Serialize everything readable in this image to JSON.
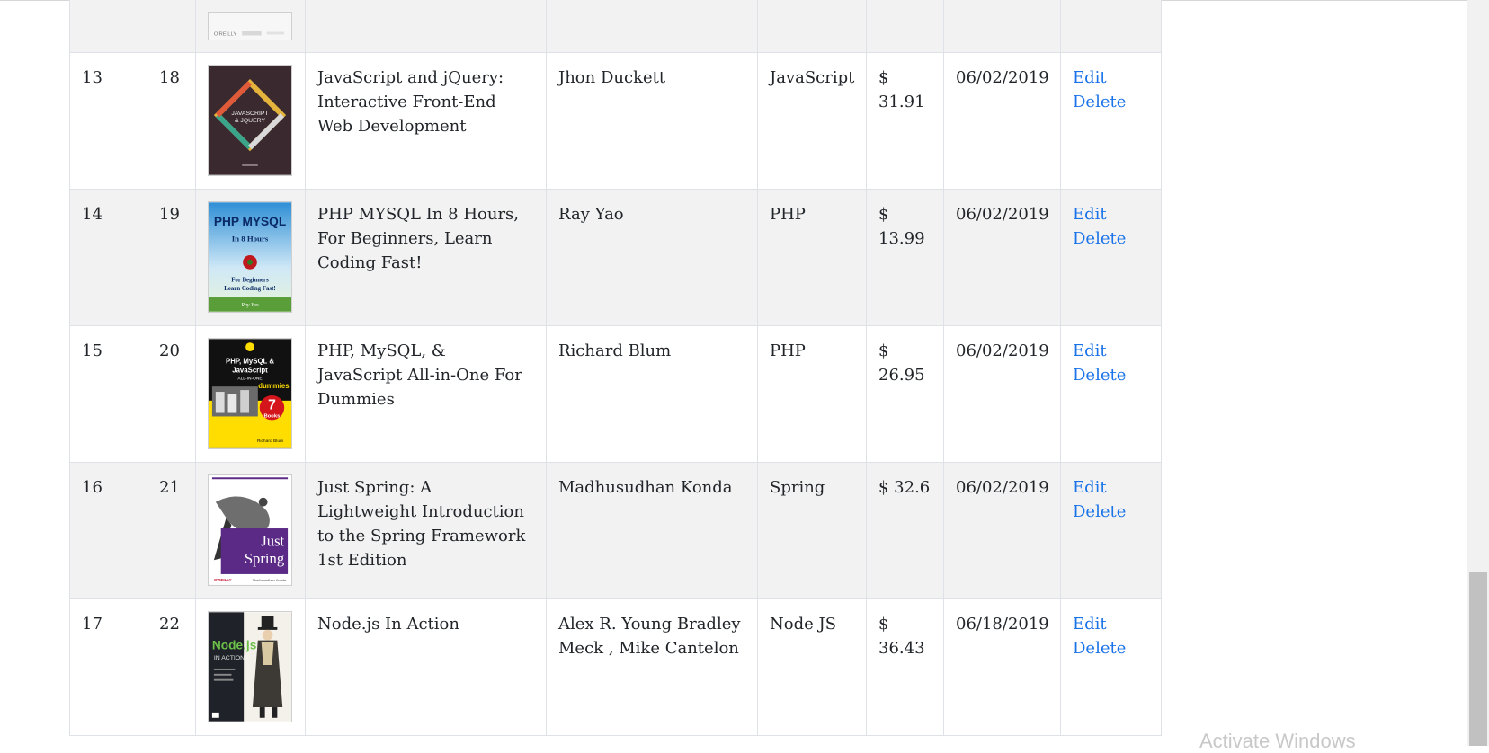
{
  "table": {
    "rows": [
      {
        "num": "",
        "id": "",
        "title": "",
        "author": "",
        "category": "",
        "price": "",
        "date": "",
        "edit": "",
        "delete": ""
      },
      {
        "num": "13",
        "id": "18",
        "title": "JavaScript and jQuery: Interactive Front-End Web Development",
        "author": "Jhon Duckett",
        "category": "JavaScript",
        "price": "$ 31.91",
        "date": "06/02/2019",
        "edit": "Edit",
        "delete": "Delete"
      },
      {
        "num": "14",
        "id": "19",
        "title": "PHP MYSQL In 8 Hours, For Beginners, Learn Coding Fast!",
        "author": "Ray Yao",
        "category": "PHP",
        "price": "$ 13.99",
        "date": "06/02/2019",
        "edit": "Edit",
        "delete": "Delete"
      },
      {
        "num": "15",
        "id": "20",
        "title": "PHP, MySQL, & JavaScript All-in-One For Dummies",
        "author": "Richard Blum",
        "category": "PHP",
        "price": "$ 26.95",
        "date": "06/02/2019",
        "edit": "Edit",
        "delete": "Delete"
      },
      {
        "num": "16",
        "id": "21",
        "title": "Just Spring: A Lightweight Introduction to the Spring Framework 1st Edition",
        "author": "Madhusudhan Konda",
        "category": "Spring",
        "price": "$ 32.6",
        "date": "06/02/2019",
        "edit": "Edit",
        "delete": "Delete"
      },
      {
        "num": "17",
        "id": "22",
        "title": "Node.js In Action",
        "author": "Alex R. Young Bradley Meck , Mike Cantelon",
        "category": "Node JS",
        "price": "$ 36.43",
        "date": "06/18/2019",
        "edit": "Edit",
        "delete": "Delete"
      }
    ]
  },
  "covers": {
    "partial": {
      "text": "O'REILLY"
    },
    "js_jquery": {
      "line1": "JAVASCRIPT",
      "line2": "& JQUERY"
    },
    "php_mysql": {
      "line1": "PHP MYSQL",
      "line2": "In 8 Hours",
      "line3": "For Beginners",
      "line4": "Learn Coding Fast!",
      "line5": "Ray Yao"
    },
    "dummies": {
      "line1": "PHP, MySQL &",
      "line2": "JavaScript",
      "line3": "ALL-IN-ONE",
      "line4": "dummies",
      "line5": "7",
      "line6": "Books",
      "line7": "Richard Blum"
    },
    "spring": {
      "line1": "Just",
      "line2": "Spring",
      "line3": "O'REILLY",
      "line4": "Madhusudhan Konda"
    },
    "node": {
      "line1": "Node.js",
      "line2": "IN ACTION"
    }
  },
  "watermark": "Activate Windows",
  "colors": {
    "link": "#1a73e8",
    "stripe": "#f2f2f2",
    "border": "#dee2e6"
  }
}
